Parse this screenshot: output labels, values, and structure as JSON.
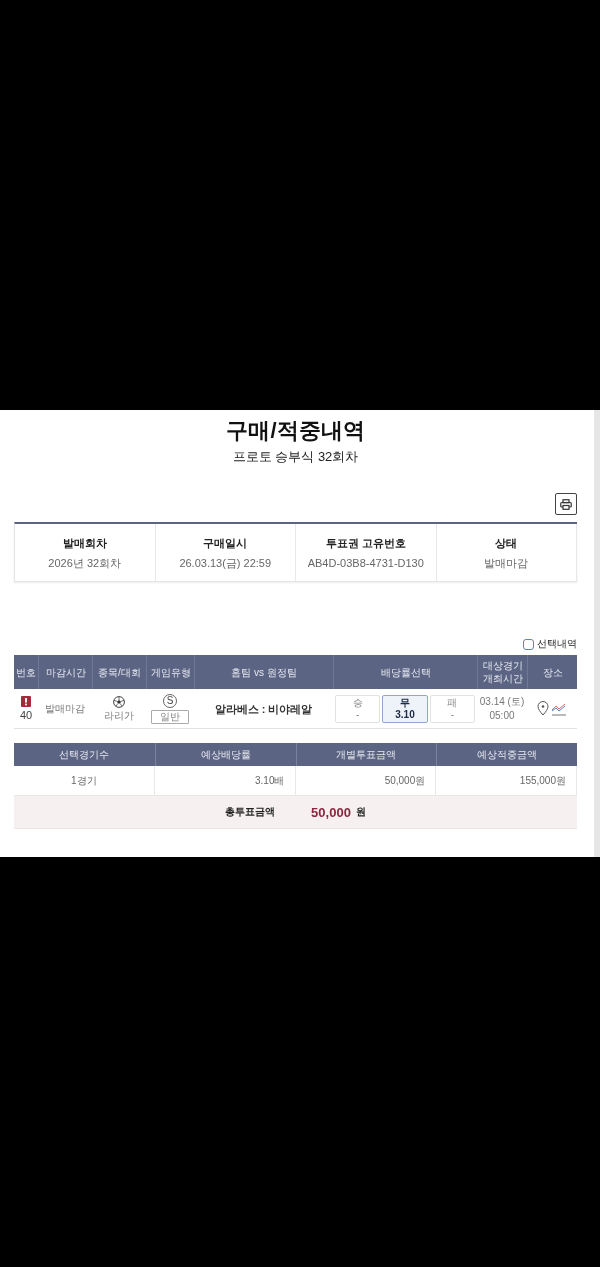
{
  "page": {
    "title": "구매/적중내역",
    "subtitle": "프로토 승부식 32회차"
  },
  "info": [
    {
      "label": "발매회차",
      "value": "2026년 32회차"
    },
    {
      "label": "구매일시",
      "value": "26.03.13(금) 22:59"
    },
    {
      "label": "투표권 고유번호",
      "value": "AB4D-03B8-4731-D130"
    },
    {
      "label": "상태",
      "value": "발매마감"
    }
  ],
  "selection_filter": {
    "label": "선택내역",
    "checked": false
  },
  "games_table": {
    "columns": [
      "번호",
      "마감시간",
      "종목/대회",
      "게임유형",
      "홈팀 vs 원정팀",
      "배당률선택",
      "대상경기 개최시간",
      "장소"
    ],
    "rows": [
      {
        "number": "40",
        "warning": true,
        "deadline": "발매마감",
        "league": "라리가",
        "type_mark": "S",
        "game_type": "일반",
        "matchup": "알라베스 : 비야레알",
        "odds": [
          {
            "label": "승",
            "value": "-",
            "selected": false
          },
          {
            "label": "무",
            "value": "3.10",
            "selected": true
          },
          {
            "label": "패",
            "value": "-",
            "selected": false
          }
        ],
        "date": "03.14 (토)",
        "time": "05:00"
      }
    ]
  },
  "summary": {
    "columns": [
      "선택경기수",
      "예상배당률",
      "개별투표금액",
      "예상적중금액"
    ],
    "values": [
      "1경기",
      "3.10배",
      "50,000원",
      "155,000원"
    ],
    "total": {
      "label": "총투표금액",
      "amount": "50,000",
      "unit": "원"
    }
  }
}
